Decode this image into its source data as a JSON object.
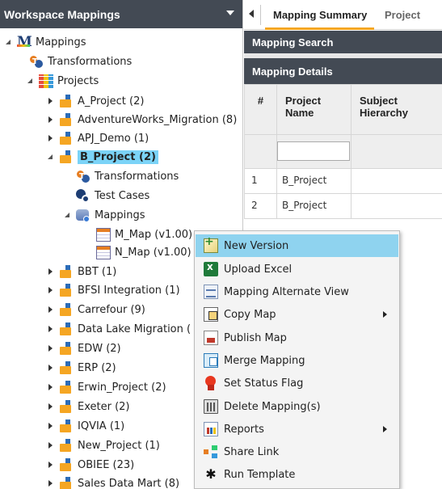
{
  "left_panel": {
    "title": "Workspace Mappings",
    "tree": {
      "root": "Mappings",
      "root_transformations": "Transformations",
      "projects_label": "Projects",
      "projects": [
        {
          "label": "A_Project (2)"
        },
        {
          "label": "AdventureWorks_Migration (8)"
        },
        {
          "label": "APJ_Demo (1)"
        },
        {
          "label": "B_Project (2)",
          "selected": true,
          "children": {
            "transformations": "Transformations",
            "test_cases": "Test Cases",
            "mappings": "Mappings",
            "maps": [
              "M_Map (v1.00)",
              "N_Map (v1.00)"
            ]
          }
        },
        {
          "label": "BBT (1)"
        },
        {
          "label": "BFSI Integration (1)"
        },
        {
          "label": "Carrefour (9)"
        },
        {
          "label": "Data Lake Migration ("
        },
        {
          "label": "EDW (2)"
        },
        {
          "label": "ERP (2)"
        },
        {
          "label": "Erwin_Project (2)"
        },
        {
          "label": "Exeter (2)"
        },
        {
          "label": "IQVIA (1)"
        },
        {
          "label": "New_Project (1)"
        },
        {
          "label": "OBIEE (23)"
        },
        {
          "label": "Sales Data Mart (8)"
        }
      ]
    }
  },
  "right_panel": {
    "tabs": [
      "Mapping Summary",
      "Project"
    ],
    "search_title": "Mapping Search",
    "details_title": "Mapping Details",
    "columns": [
      "#",
      "Project Name",
      "Subject Hierarchy"
    ],
    "rows": [
      {
        "num": "1",
        "project": "B_Project"
      },
      {
        "num": "2",
        "project": "B_Project"
      }
    ]
  },
  "context_menu": {
    "items": [
      {
        "label": "New Version",
        "icon": "new-version-icon",
        "highlighted": true
      },
      {
        "label": "Upload Excel",
        "icon": "excel-icon"
      },
      {
        "label": "Mapping Alternate View",
        "icon": "alternate-view-icon"
      },
      {
        "label": "Copy Map",
        "icon": "copy-icon",
        "submenu": true
      },
      {
        "label": "Publish Map",
        "icon": "publish-icon"
      },
      {
        "label": "Merge Mapping",
        "icon": "merge-icon"
      },
      {
        "label": "Set Status Flag",
        "icon": "status-flag-icon"
      },
      {
        "label": "Delete Mapping(s)",
        "icon": "delete-icon"
      },
      {
        "label": "Reports",
        "icon": "reports-icon",
        "submenu": true
      },
      {
        "label": "Share Link",
        "icon": "share-link-icon"
      },
      {
        "label": "Run Template",
        "icon": "run-template-icon"
      }
    ]
  },
  "colors": {
    "header_bg": "#434a54",
    "selection": "#7bd3f7",
    "menu_highlight": "#8fd3ef",
    "tab_underline": "#f5a623"
  }
}
